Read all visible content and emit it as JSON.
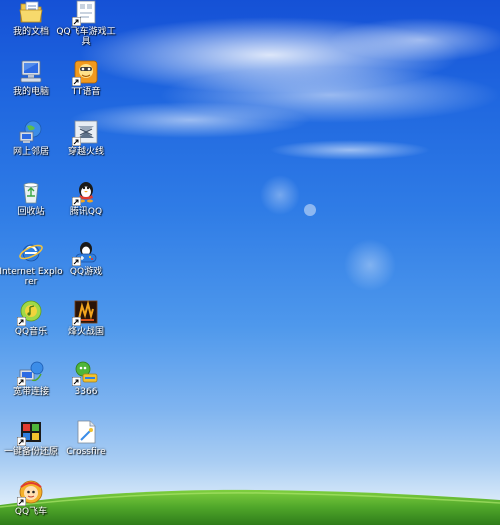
{
  "desktop": {
    "icons": [
      {
        "label": "我的文档",
        "icon": "my-documents-icon",
        "shortcut": false
      },
      {
        "label": "我的电脑",
        "icon": "my-computer-icon",
        "shortcut": false
      },
      {
        "label": "网上邻居",
        "icon": "network-places-icon",
        "shortcut": false
      },
      {
        "label": "回收站",
        "icon": "recycle-bin-icon",
        "shortcut": false
      },
      {
        "label": "Internet Explorer",
        "icon": "internet-explorer-icon",
        "shortcut": false
      },
      {
        "label": "QQ音乐",
        "icon": "qq-music-icon",
        "shortcut": true
      },
      {
        "label": "宽带连接",
        "icon": "broadband-connection-icon",
        "shortcut": true
      },
      {
        "label": "一键备份还原",
        "icon": "backup-restore-icon",
        "shortcut": true
      },
      {
        "label": "QQ飞车",
        "icon": "qq-speed-icon",
        "shortcut": true
      },
      {
        "label": "QQ飞车游戏工具",
        "icon": "qq-speed-tool-icon",
        "shortcut": true
      },
      {
        "label": "TT语音",
        "icon": "tt-voice-icon",
        "shortcut": true
      },
      {
        "label": "穿越火线",
        "icon": "crossfire-game-icon",
        "shortcut": true
      },
      {
        "label": "腾讯QQ",
        "icon": "tencent-qq-icon",
        "shortcut": true
      },
      {
        "label": "QQ游戏",
        "icon": "qq-game-icon",
        "shortcut": true
      },
      {
        "label": "烽火战国",
        "icon": "fenghuo-zhanguo-icon",
        "shortcut": true
      },
      {
        "label": "3366",
        "icon": "3366-game-icon",
        "shortcut": true
      },
      {
        "label": "Crossfire",
        "icon": "crossfire-file-icon",
        "shortcut": false
      }
    ]
  }
}
